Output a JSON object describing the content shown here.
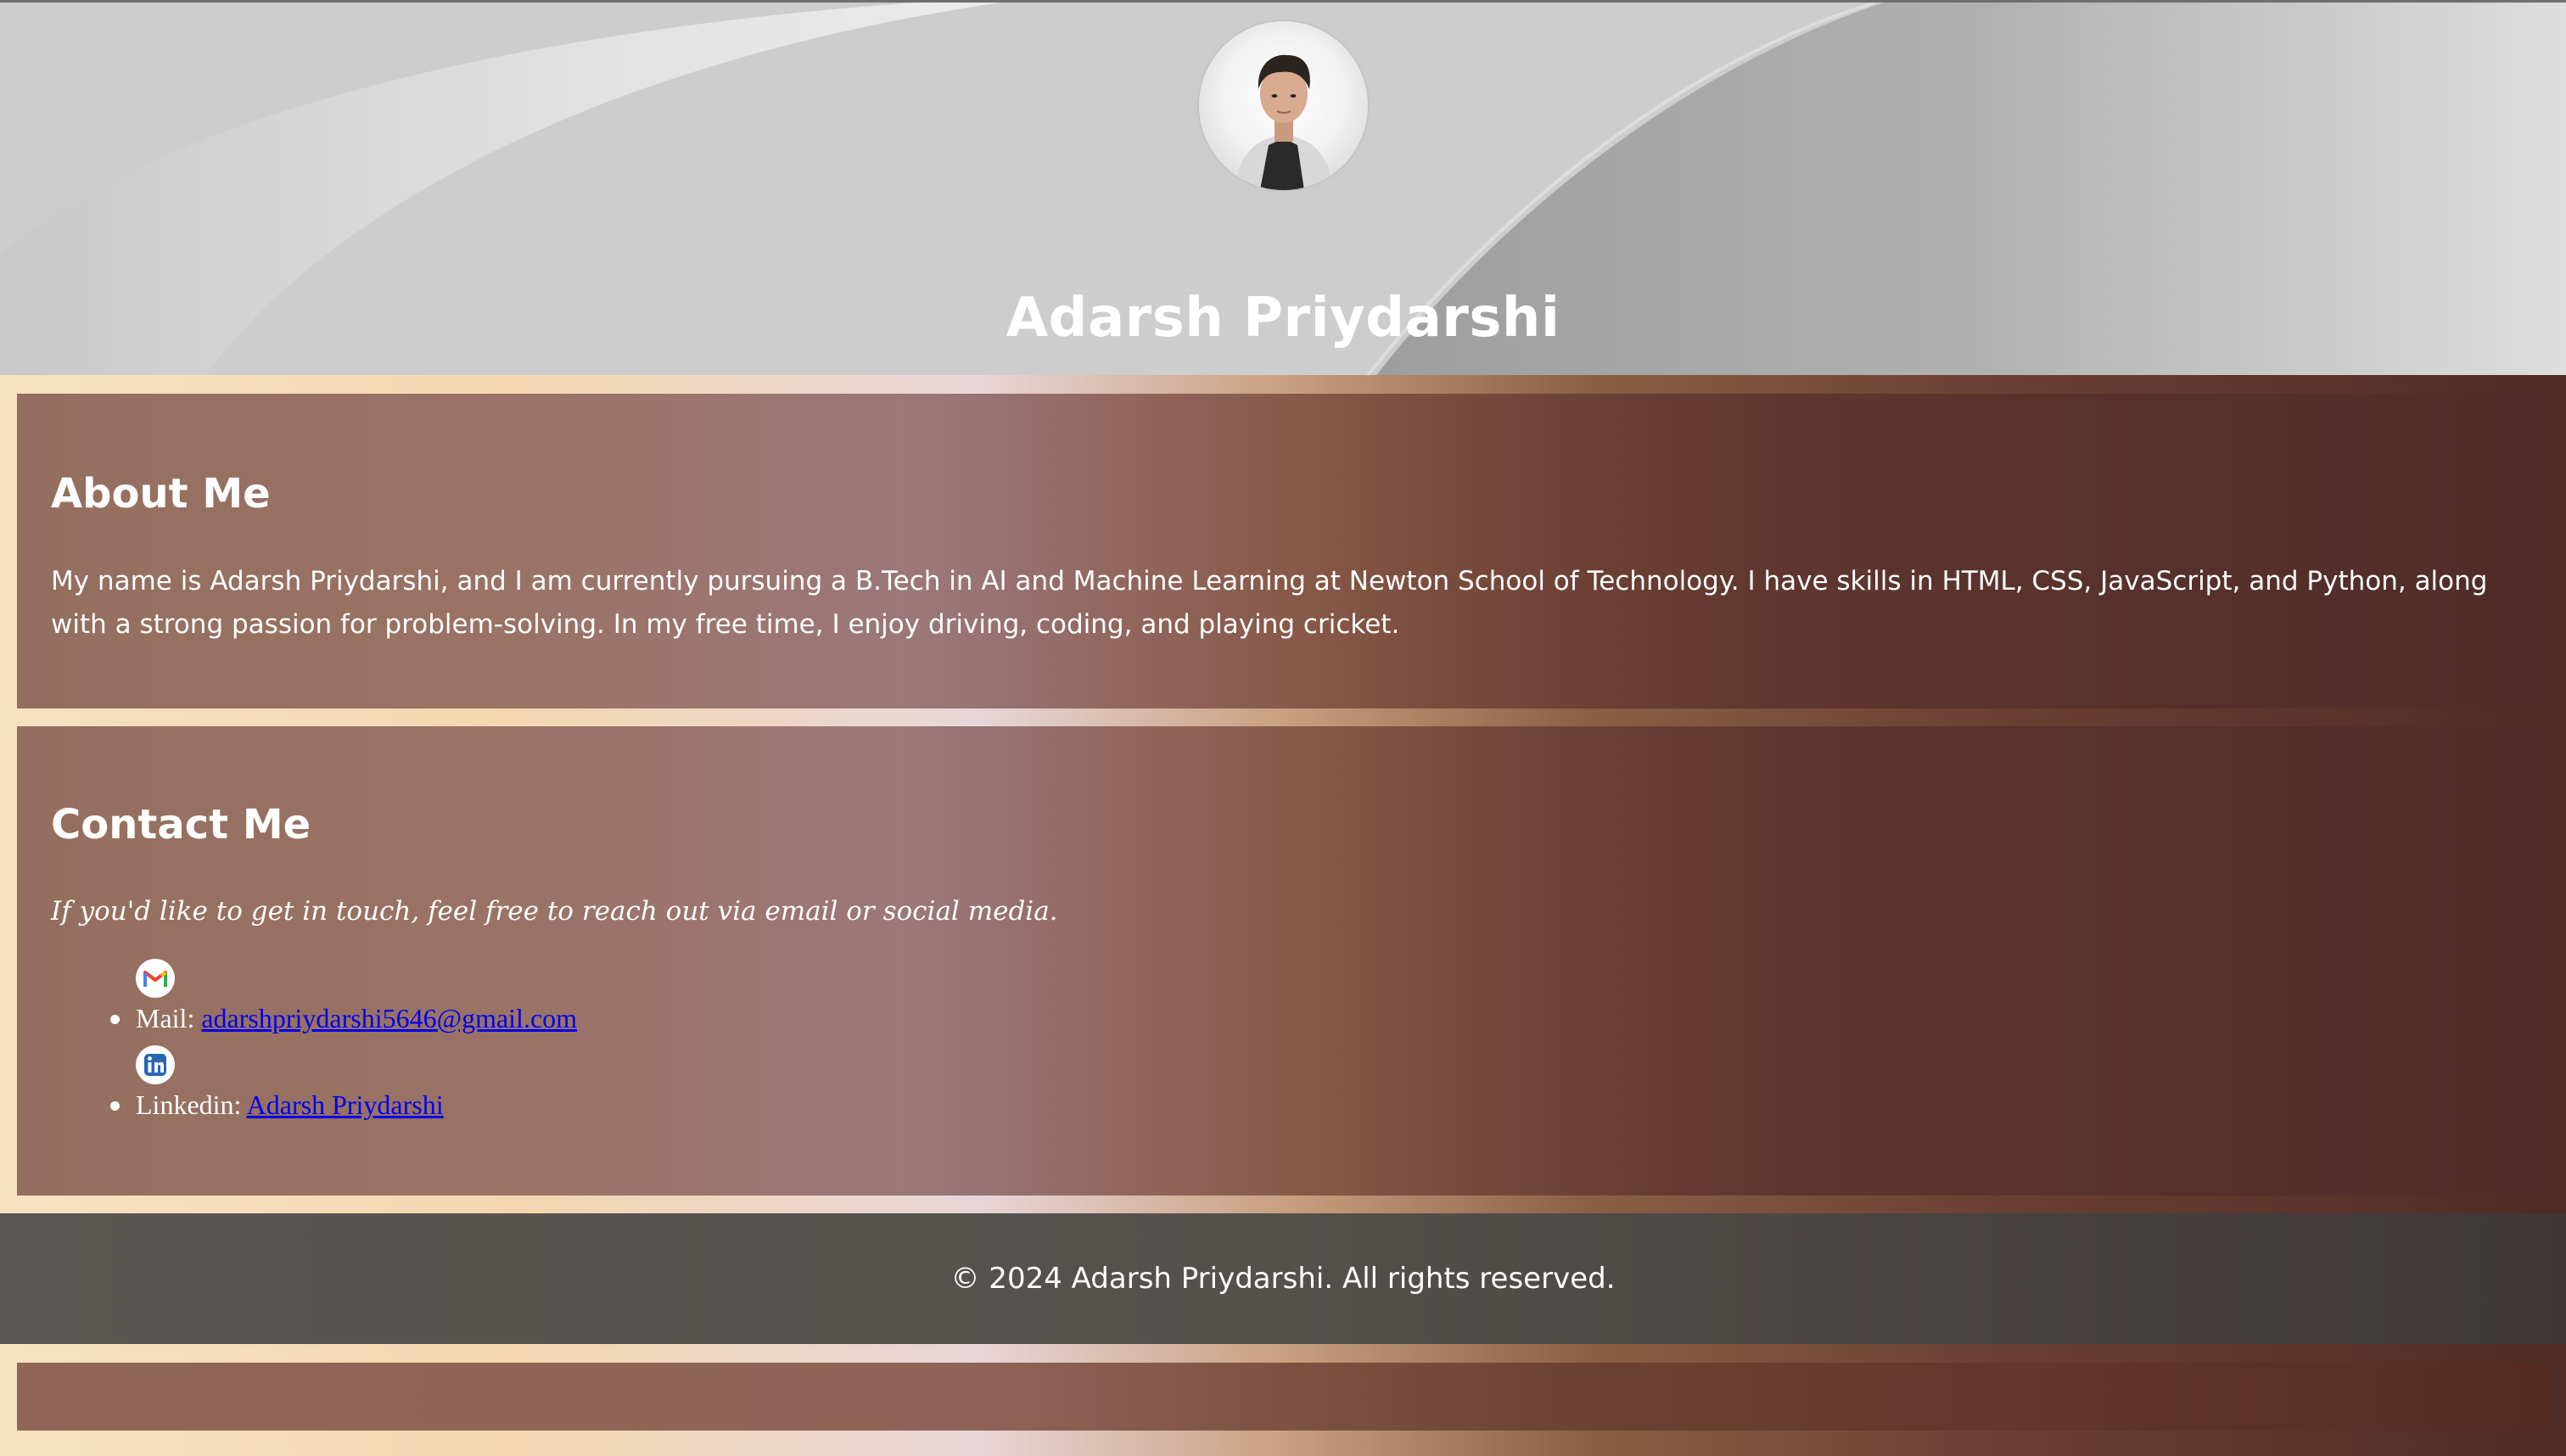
{
  "header": {
    "name": "Adarsh Priydarshi",
    "avatar_icon": "profile-photo"
  },
  "about": {
    "title": "About Me",
    "text": "My name is Adarsh Priydarshi, and I am currently pursuing a B.Tech in AI and Machine Learning at Newton School of Technology. I have skills in HTML, CSS, JavaScript, and Python, along with a strong passion for problem-solving. In my free time, I enjoy driving, coding, and playing cricket."
  },
  "contact": {
    "title": "Contact Me",
    "intro": "If you'd like to get in touch, feel free to reach out via email or social media.",
    "items": [
      {
        "icon": "gmail-icon",
        "label": "Mail:",
        "link_text": "adarshpriydarshi5646@gmail.com"
      },
      {
        "icon": "linkedin-icon",
        "label": "Linkedin:",
        "link_text": "Adarsh Priydarshi"
      }
    ]
  },
  "footer": {
    "text": "© 2024 Adarsh Priydarshi. All rights reserved."
  },
  "colors": {
    "link": "#0000ee",
    "footer_bg": "#55514d",
    "card_bg": "#7a4f45"
  }
}
